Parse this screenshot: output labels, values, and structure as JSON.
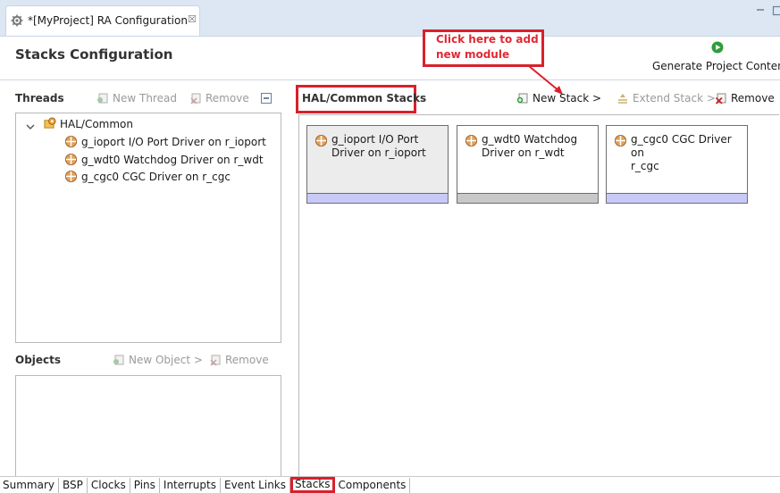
{
  "editor_tab": {
    "title": "*[MyProject] RA Configuration",
    "close_glyph": "☒"
  },
  "header": {
    "title": "Stacks Configuration",
    "generate_label": "Generate Project Content"
  },
  "callout": {
    "text": "Click here to add new module"
  },
  "threads": {
    "title": "Threads",
    "new_thread_label": "New Thread",
    "remove_label": "Remove",
    "tree": {
      "root": "HAL/Common",
      "children": [
        "g_ioport I/O Port Driver on r_ioport",
        "g_wdt0 Watchdog Driver on r_wdt",
        "g_cgc0 CGC Driver on r_cgc"
      ]
    }
  },
  "objects": {
    "title": "Objects",
    "new_object_label": "New Object >",
    "remove_label": "Remove"
  },
  "stacks": {
    "title": "HAL/Common Stacks",
    "new_stack_label": "New Stack >",
    "extend_stack_label": "Extend Stack >",
    "remove_label": "Remove",
    "modules": [
      {
        "line1": "g_ioport I/O Port",
        "line2": "Driver on r_ioport"
      },
      {
        "line1": "g_wdt0 Watchdog",
        "line2": "Driver on r_wdt"
      },
      {
        "line1": "g_cgc0 CGC Driver on",
        "line2": "r_cgc"
      }
    ]
  },
  "bottom_tabs": [
    "Summary",
    "BSP",
    "Clocks",
    "Pins",
    "Interrupts",
    "Event Links",
    "Stacks",
    "Components"
  ],
  "colors": {
    "accent_red": "#d9202c",
    "generate_green": "#2e9e3a",
    "module_bar": "#c7c9f6"
  },
  "icons": [
    "gear-icon",
    "generate-icon",
    "new-thread-icon",
    "remove-icon",
    "collapse-icon",
    "stack-module-icon",
    "new-stack-icon",
    "extend-stack-icon"
  ]
}
